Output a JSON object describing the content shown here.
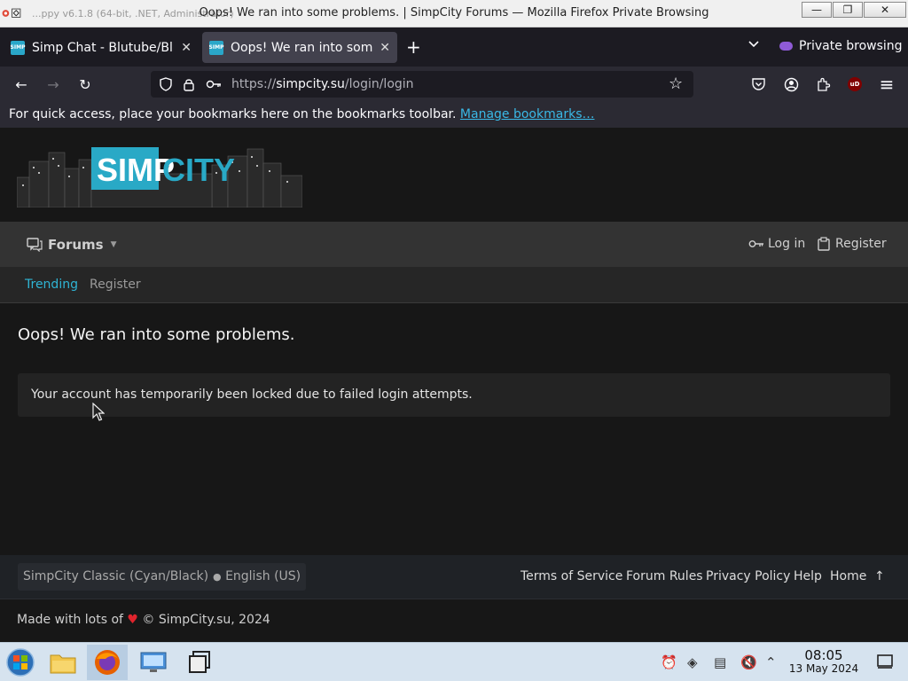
{
  "window": {
    "title": "Oops! We ran into some problems. | SimpCity Forums — Mozilla Firefox Private Browsing",
    "app_hint": "...ppy v6.1.8 (64-bit, .NET, Administrator)",
    "minimize": "—",
    "maximize": "❐",
    "close": "✕"
  },
  "tabs": [
    {
      "label": "Simp Chat - Blutube/Blul",
      "favicon_text": "SIMP",
      "active": false
    },
    {
      "label": "Oops! We ran into some",
      "favicon_text": "SIMP",
      "active": true
    }
  ],
  "tabstrip": {
    "new_tab": "+",
    "list_all": "⌄",
    "private_label": "Private browsing"
  },
  "navbar": {
    "url_scheme": "https://",
    "url_host": "simpcity.su",
    "url_path": "/login/login",
    "back": "←",
    "forward": "→",
    "reload": "↻",
    "bookmark_star": "☆",
    "menu": "≡",
    "ublock_label": "uD"
  },
  "bookmarks_bar": {
    "message": "For quick access, place your bookmarks here on the bookmarks toolbar.",
    "link": "Manage bookmarks…"
  },
  "site": {
    "logo_text_left": "SIMP",
    "logo_text_right": "CITY",
    "nav": {
      "forums": "Forums",
      "login": "Log in",
      "register": "Register"
    },
    "subnav": {
      "trending": "Trending",
      "register": "Register"
    },
    "page_title": "Oops! We ran into some problems.",
    "error_message": "Your account has temporarily been locked due to failed login attempts.",
    "footer": {
      "style_chooser": "SimpCity Classic (Cyan/Black)",
      "language": "English (US)",
      "links": [
        "Terms of Service",
        "Forum Rules",
        "Privacy Policy",
        "Help",
        "Home"
      ],
      "to_top": "↑",
      "copyright_pre": "Made with lots of",
      "heart": "♥",
      "copyright_post": "© SimpCity.su, 2024"
    },
    "colors": {
      "accent_cyan": "#2fb4d4",
      "background": "#171717",
      "nav_bar": "#333333"
    }
  },
  "taskbar": {
    "time": "08:05",
    "date": "13 May 2024"
  }
}
